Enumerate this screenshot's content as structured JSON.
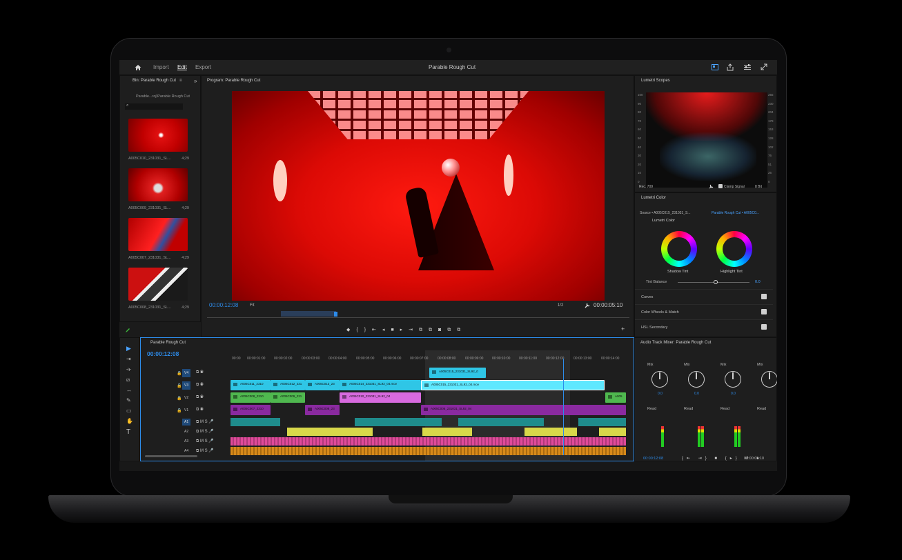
{
  "topbar": {
    "tabs": [
      "Import",
      "Edit",
      "Export"
    ],
    "active_tab": "Edit",
    "title": "Parable Rough Cut"
  },
  "bin": {
    "title": "Bin: Parable Rough Cut",
    "path": "Parable...roj\\Parable Rough Cut",
    "items": [
      {
        "name": "A005C010_231031_SL...",
        "duration": "4;29"
      },
      {
        "name": "A005C009_231031_SL...",
        "duration": "4;29"
      },
      {
        "name": "A005C007_231031_SL...",
        "duration": "4;29"
      },
      {
        "name": "A005C008_231031_SL...",
        "duration": "4;29"
      }
    ]
  },
  "program": {
    "title": "Program: Parable Rough Cut",
    "timecode": "00:00:12:08",
    "zoom": "Fit",
    "resolution": "1/2",
    "duration": "00:00:05:10"
  },
  "scopes": {
    "title": "Lumetri Scopes",
    "left_scale": [
      "100",
      "90",
      "80",
      "70",
      "60",
      "50",
      "40",
      "30",
      "20",
      "10",
      "0"
    ],
    "right_scale": [
      "255",
      "230",
      "204",
      "178",
      "153",
      "128",
      "102",
      "76",
      "51",
      "26",
      "0"
    ],
    "standard": "Rec. 709",
    "clamp_label": "Clamp Signal",
    "bit_depth": "8 Bit"
  },
  "lumetri_color": {
    "title": "Lumetri Color",
    "source": "Source • A005C015_231031_S...",
    "sequence": "Parable Rough Cut • A005C0...",
    "effect": "Lumetri Color",
    "shadow_label": "Shadow Tint",
    "highlight_label": "Highlight Tint",
    "tint_balance_label": "Tint Balance",
    "tint_balance_value": "0.0",
    "sections": [
      "Curves",
      "Color Wheels & Match",
      "HSL Secondary"
    ]
  },
  "timeline": {
    "title": "Parable Rough Cut",
    "timecode": "00:00:12:08",
    "ruler": [
      "00:00",
      "00:00:01:00",
      "00:00:02:00",
      "00:00:03:00",
      "00:00:04:00",
      "00:00:05:00",
      "00:00:06:00",
      "00:00:07:00",
      "00:00:08:00",
      "00:00:09:00",
      "00:00:10:00",
      "00:00:11:00",
      "00:00:12:00",
      "00:00:13:00",
      "00:00:14:00"
    ],
    "video_tracks": [
      "V4",
      "V3",
      "V2",
      "V1"
    ],
    "audio_tracks": [
      "A1",
      "A2",
      "A3",
      "A4"
    ],
    "clips": {
      "v4_a": "A005C015_231031_SL92_0",
      "v3_a": "A005C011_2310",
      "v3_b": "A005C012_231",
      "v3_c": "A005C013_23",
      "v3_d": "A005C014_231031_SL92_04.mov",
      "v3_e": "A005C015_231031_SL92_04.mov",
      "v2_a": "A005C008_2310",
      "v2_b": "A005C009_231",
      "v2_c": "A005C010_231031_SL92_04",
      "v2_d": "A005",
      "v1_a": "A005C007_2310",
      "v1_b": "A005C008_23",
      "v1_c": "A005C005_231031_SL92_04"
    }
  },
  "mixer": {
    "title": "Audio Track Mixer: Parable Rough Cut",
    "channel_mode": "Mix",
    "automation": "Read",
    "pan_value": "0.0",
    "timecode": "00:00:12:08",
    "duration": "00:00:05:10"
  },
  "colors": {
    "accent": "#2d8ceb",
    "clip_cyan": "#2fc6e6",
    "clip_green": "#4fb84f",
    "clip_pink": "#d86adf",
    "clip_purple": "#8a2aa0",
    "audio_teal": "#1f8c8c",
    "audio_yellow": "#d8d84a",
    "audio_pink": "#e04a9a",
    "audio_orange": "#d88a1a"
  }
}
